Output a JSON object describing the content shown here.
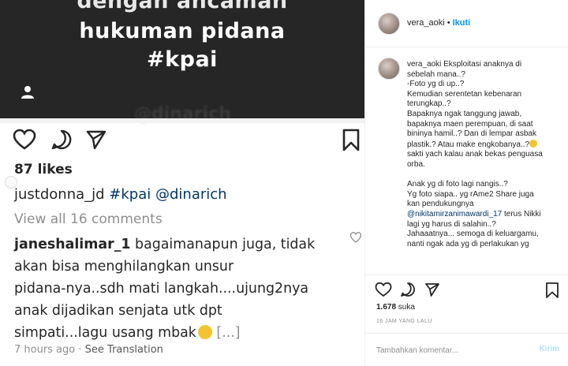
{
  "image": {
    "dark_lines": [
      "dengan ancaman",
      "hukuman pidana",
      "#kpai"
    ],
    "watermark": "@dinarich",
    "likes": "87 likes",
    "caption": {
      "user": "justdonna_jd",
      "tag1": "#kpai",
      "tag2": "@dinarich"
    },
    "view_all": "View all 16 comments",
    "comment": {
      "user": "janeshalimar_1",
      "line1": " bagaimanapun juga, tidak",
      "line2": "akan bisa menghilangkan unsur",
      "line3": "pidana-nya..sdh mati langkah....ujung2nya",
      "line4": "anak dijadikan senjata utk dpt",
      "line5": "simpati...lagu usang mbak",
      "more": " [...]"
    },
    "time": "7 hours ago",
    "see_translation": "See Translation"
  },
  "sidebar": {
    "username": "vera_aoki",
    "dot": "•",
    "follow": "Ikuti",
    "caption_user": "vera_aoki",
    "caption_lines": [
      " Eksploitasi anaknya di",
      "sebelah mana..?",
      "-Foto yg di up..?",
      "Kemudian serentetan kebenaran",
      "terungkap..?",
      "Bapaknya ngak tanggung jawab,",
      "bapaknya maen perempuan, di saat",
      "bininya hamil..? Dan di lempar asbak",
      "plastik.? Atau make engkobanya..?",
      "sakti yach kalau anak bekas penguasa",
      "orba.",
      "Anak yg di foto lagi nangis..?",
      "Yg foto siapa.. yg rAme2 Share juga",
      "kan pendukungnya",
      "@nikitamirzanimawardi_17",
      " terus Nikki",
      "lagi yg harus di salahin..?",
      "Jahaaatnya... semoga di keluargamu,",
      "nanti ngak ada yg di perlakukan yg"
    ],
    "likes_count": "1.678",
    "likes_label": " suka",
    "timestamp": "16 JAM YANG LALU",
    "comment_placeholder": "Tambahkan komentar...",
    "post_button": "Kirim"
  },
  "icons": {
    "heart": "heart-icon",
    "comment": "comment-icon",
    "share": "share-icon",
    "bookmark": "bookmark-icon"
  }
}
